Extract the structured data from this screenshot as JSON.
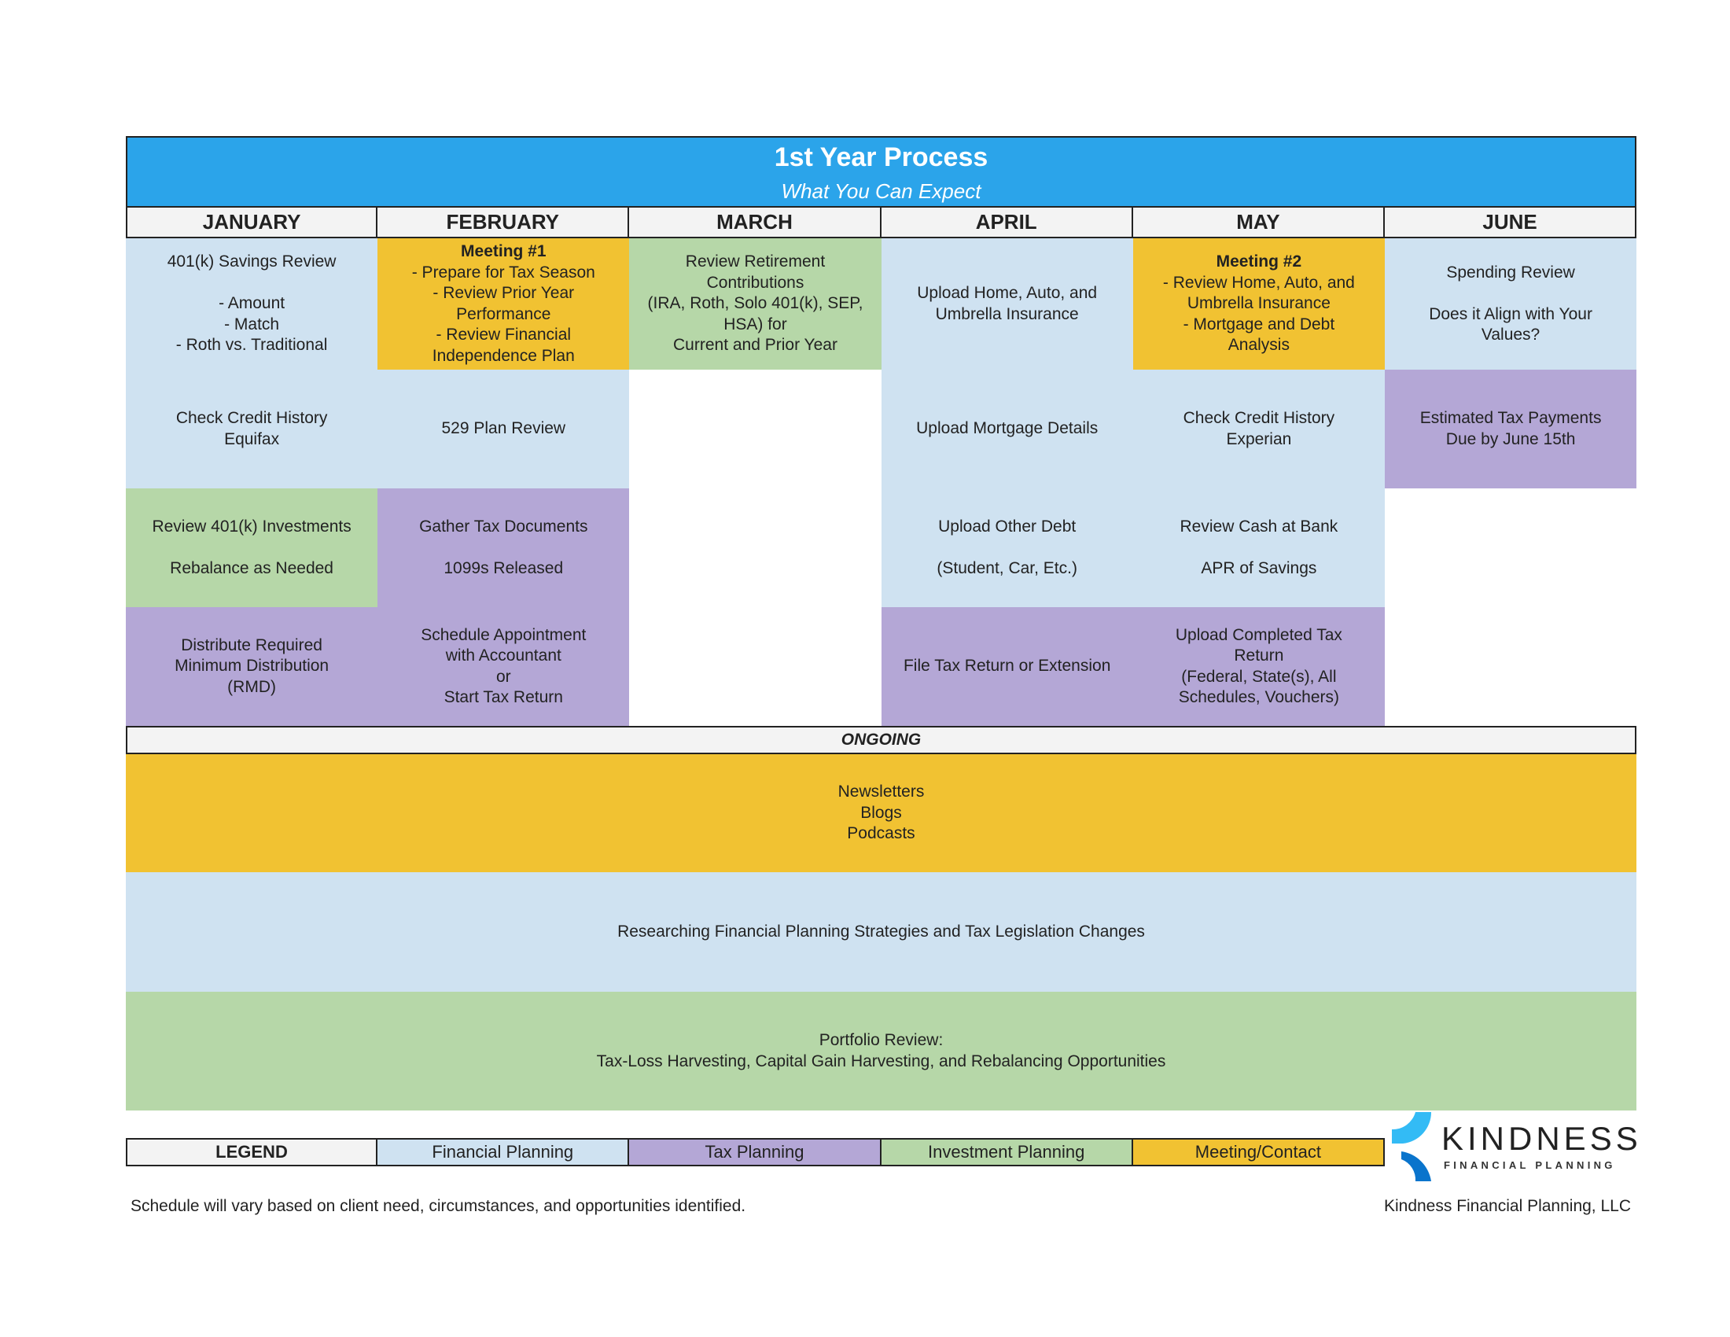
{
  "header": {
    "title": "1st Year Process",
    "subtitle": "What You Can Expect"
  },
  "months": [
    "JANUARY",
    "FEBRUARY",
    "MARCH",
    "APRIL",
    "MAY",
    "JUNE"
  ],
  "cells": [
    {
      "col": 0,
      "row": 1,
      "type": "fp",
      "title": "",
      "text": "401(k) Savings Review\n\n- Amount\n- Match\n- Roth vs. Traditional"
    },
    {
      "col": 0,
      "row": 2,
      "type": "fp",
      "title": "",
      "text": "Check Credit History\nEquifax"
    },
    {
      "col": 0,
      "row": 3,
      "type": "ip",
      "title": "",
      "text": "Review 401(k) Investments\n\nRebalance as Needed"
    },
    {
      "col": 0,
      "row": 4,
      "type": "tp",
      "title": "",
      "text": "Distribute Required\nMinimum Distribution\n(RMD)"
    },
    {
      "col": 1,
      "row": 1,
      "type": "mc",
      "title": "Meeting #1",
      "text": "- Prepare for Tax Season\n- Review Prior Year\nPerformance\n- Review Financial\nIndependence Plan"
    },
    {
      "col": 1,
      "row": 2,
      "type": "fp",
      "title": "",
      "text": "529 Plan Review"
    },
    {
      "col": 1,
      "row": 3,
      "type": "tp",
      "title": "",
      "text": "Gather Tax Documents\n\n1099s Released"
    },
    {
      "col": 1,
      "row": 4,
      "type": "tp",
      "title": "",
      "text": "Schedule Appointment\nwith Accountant\nor\nStart Tax Return"
    },
    {
      "col": 2,
      "row": 1,
      "type": "ip",
      "title": "",
      "text": "Review Retirement\nContributions\n(IRA, Roth, Solo 401(k), SEP,\nHSA) for\nCurrent and Prior Year"
    },
    {
      "col": 3,
      "row": 1,
      "type": "fp",
      "title": "",
      "text": "Upload Home, Auto, and\nUmbrella Insurance"
    },
    {
      "col": 3,
      "row": 2,
      "type": "fp",
      "title": "",
      "text": "Upload Mortgage Details"
    },
    {
      "col": 3,
      "row": 3,
      "type": "fp",
      "title": "",
      "text": "Upload Other Debt\n\n(Student, Car, Etc.)"
    },
    {
      "col": 3,
      "row": 4,
      "type": "tp",
      "title": "",
      "text": "File Tax Return or Extension"
    },
    {
      "col": 4,
      "row": 1,
      "type": "mc",
      "title": "Meeting #2",
      "text": "- Review Home, Auto, and\nUmbrella Insurance\n- Mortgage and Debt\nAnalysis"
    },
    {
      "col": 4,
      "row": 2,
      "type": "fp",
      "title": "",
      "text": "Check Credit History\nExperian"
    },
    {
      "col": 4,
      "row": 3,
      "type": "fp",
      "title": "",
      "text": "Review Cash at Bank\n\nAPR of Savings"
    },
    {
      "col": 4,
      "row": 4,
      "type": "tp",
      "title": "",
      "text": "Upload Completed Tax\nReturn\n(Federal, State(s), All\nSchedules, Vouchers)"
    },
    {
      "col": 5,
      "row": 1,
      "type": "fp",
      "title": "",
      "text": "Spending Review\n\nDoes it Align with Your\nValues?"
    },
    {
      "col": 5,
      "row": 2,
      "type": "tp",
      "title": "",
      "text": "Estimated Tax Payments\nDue by June 15th"
    }
  ],
  "ongoing": {
    "label": "ONGOING",
    "rows": [
      {
        "type": "mc",
        "text": "Newsletters\nBlogs\nPodcasts"
      },
      {
        "type": "fp",
        "text": "Researching Financial Planning Strategies and Tax Legislation Changes"
      },
      {
        "type": "ip",
        "text": "Portfolio Review:\nTax-Loss Harvesting, Capital Gain Harvesting, and Rebalancing Opportunities"
      }
    ]
  },
  "legend": {
    "label": "LEGEND",
    "items": [
      {
        "type": "fp",
        "label": "Financial Planning"
      },
      {
        "type": "tp",
        "label": "Tax Planning"
      },
      {
        "type": "ip",
        "label": "Investment Planning"
      },
      {
        "type": "mc",
        "label": "Meeting/Contact"
      }
    ]
  },
  "colors": {
    "header": "#2ba4ea",
    "fp": "#cfe2f1",
    "tp": "#b4a7d6",
    "ip": "#b6d7a8",
    "mc": "#f1c232",
    "logo_light": "#33bbf5",
    "logo_dark": "#0a74cc"
  },
  "logo": {
    "name": "KINDNESS",
    "tagline": "FINANCIAL PLANNING"
  },
  "footer": {
    "note": "Schedule will vary based on client need, circumstances, and opportunities identified.",
    "company": "Kindness Financial Planning, LLC"
  }
}
